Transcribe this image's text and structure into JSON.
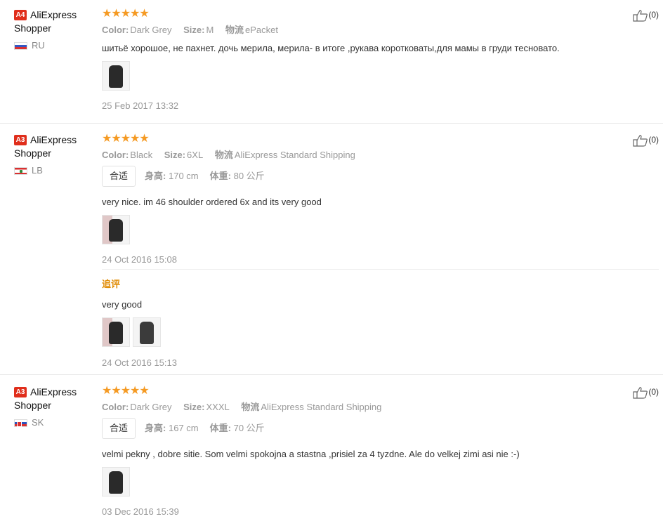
{
  "reviews": [
    {
      "badge": "A4",
      "user_first": "AliExpress",
      "user_second": "Shopper",
      "country": "RU",
      "stars": "★★★★★",
      "color_label": "Color:",
      "color_value": "Dark Grey",
      "size_label": "Size:",
      "size_value": "M",
      "shipping_label": "物流",
      "shipping_value": "ePacket",
      "text": "шитьё хорошое, не пахнет. дочь мерила, мерила- в итоге ,рукава коротковаты,для мамы в груди тесновато.",
      "date": "25 Feb 2017 13:32",
      "likes": "(0)"
    },
    {
      "badge": "A3",
      "user_first": "AliExpress",
      "user_second": "Shopper",
      "country": "LB",
      "stars": "★★★★★",
      "color_label": "Color:",
      "color_value": "Black",
      "size_label": "Size:",
      "size_value": "6XL",
      "shipping_label": "物流",
      "shipping_value": "AliExpress Standard Shipping",
      "fit_tag": "合适",
      "height_label": "身高:",
      "height_value": "170 cm",
      "weight_label": "体重:",
      "weight_value": "80 公斤",
      "text": "very nice. im 46 shoulder ordered 6x and its very good",
      "date": "24 Oct 2016 15:08",
      "likes": "(0)",
      "additional": {
        "label": "追评",
        "text": "very good",
        "date": "24 Oct 2016 15:13"
      }
    },
    {
      "badge": "A3",
      "user_first": "AliExpress",
      "user_second": "Shopper",
      "country": "SK",
      "stars": "★★★★★",
      "color_label": "Color:",
      "color_value": "Dark Grey",
      "size_label": "Size:",
      "size_value": "XXXL",
      "shipping_label": "物流",
      "shipping_value": "AliExpress Standard Shipping",
      "fit_tag": "合适",
      "height_label": "身高:",
      "height_value": "167 cm",
      "weight_label": "体重:",
      "weight_value": "70 公斤",
      "text": "velmi pekny , dobre sitie. Som velmi spokojna a stastna ,prisiel za 4 tyzdne. Ale do velkej zimi asi nie :-)",
      "date": "03 Dec 2016 15:39",
      "likes": "(0)"
    }
  ],
  "colors": {
    "star": "#f59a23",
    "badge": "#e02e1b",
    "followup": "#e08a00"
  },
  "icons": [
    "thumbs-up-icon",
    "flag-icon"
  ]
}
